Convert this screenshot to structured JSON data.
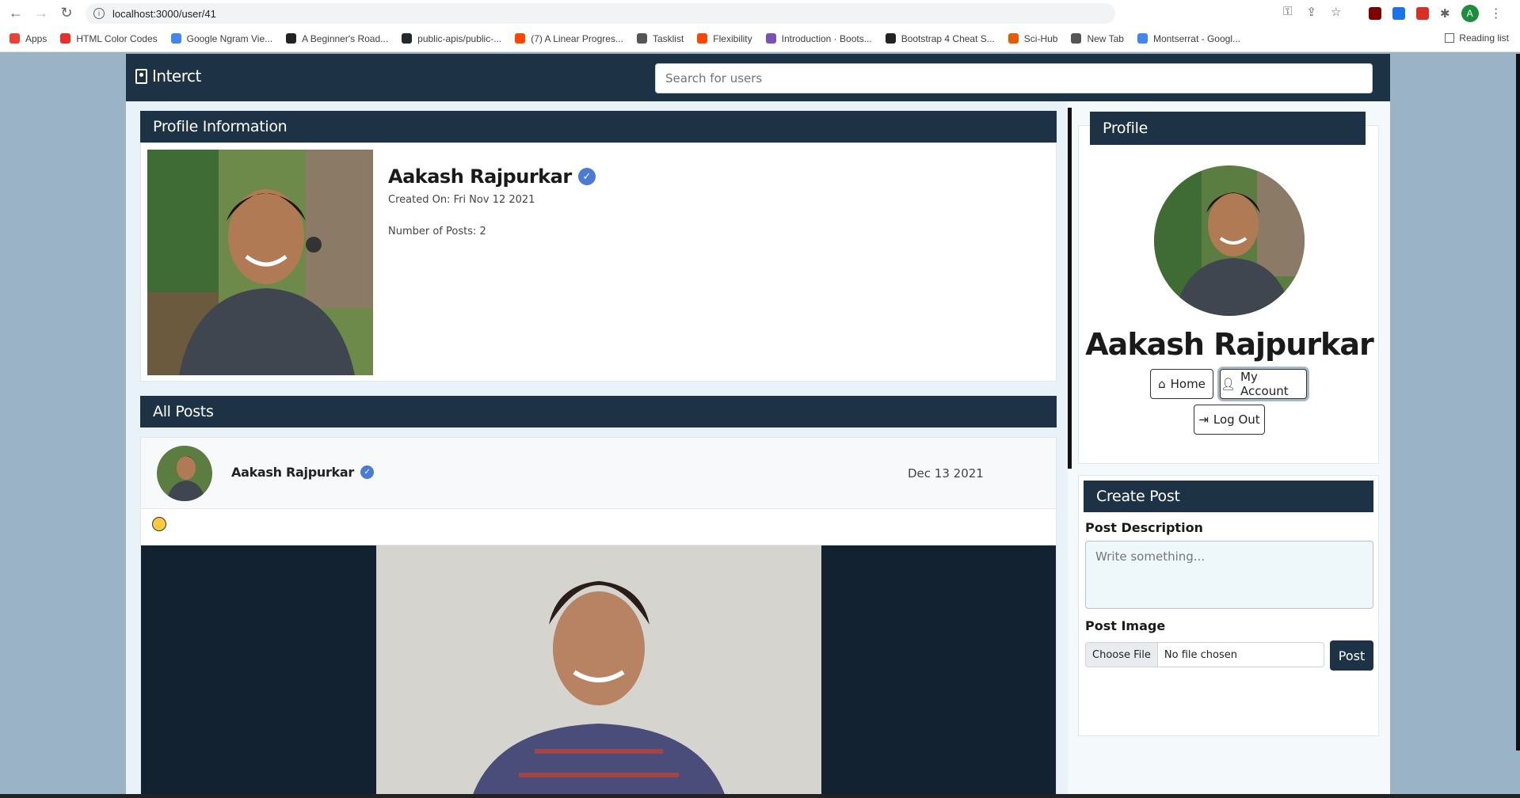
{
  "browser": {
    "url": "localhost:3000/user/41",
    "bookmarks": [
      {
        "label": "Apps",
        "color": "#ea4335"
      },
      {
        "label": "HTML Color Codes",
        "color": "#e4312b"
      },
      {
        "label": "Google Ngram Vie...",
        "color": "#4285f4"
      },
      {
        "label": "A Beginner's Road...",
        "color": "#222222"
      },
      {
        "label": "public-apis/public-...",
        "color": "#24292e"
      },
      {
        "label": "(7) A Linear Progres...",
        "color": "#ff4500"
      },
      {
        "label": "Tasklist",
        "color": "#555555"
      },
      {
        "label": "Flexibility",
        "color": "#ff4500"
      },
      {
        "label": "Introduction · Boots...",
        "color": "#7952b3"
      },
      {
        "label": "Bootstrap 4 Cheat S...",
        "color": "#222222"
      },
      {
        "label": "Sci-Hub",
        "color": "#e65c00"
      },
      {
        "label": "New Tab",
        "color": "#555555"
      },
      {
        "label": "Montserrat - Googl...",
        "color": "#4285f4"
      }
    ],
    "reading_list": "Reading list",
    "profile_initial": "A"
  },
  "nav": {
    "brand": "Interct",
    "search_placeholder": "Search for users"
  },
  "profile_info": {
    "header": "Profile Information",
    "name": "Aakash Rajpurkar",
    "created_on": "Created On: Fri Nov 12 2021",
    "num_posts": "Number of Posts: 2"
  },
  "all_posts": {
    "header": "All Posts",
    "posts": [
      {
        "author": "Aakash Rajpurkar",
        "date": "Dec 13 2021"
      }
    ]
  },
  "sidebar": {
    "header": "Profile",
    "name": "Aakash Rajpurkar",
    "home_label": "Home",
    "account_label": "My Account",
    "logout_label": "Log Out"
  },
  "create_post": {
    "header": "Create Post",
    "desc_label": "Post Description",
    "desc_placeholder": "Write something...",
    "image_label": "Post Image",
    "choose_file": "Choose File",
    "no_file": "No file chosen",
    "post_button": "Post"
  },
  "colors": {
    "navy": "#1e3246",
    "verified": "#4b7bd6"
  }
}
